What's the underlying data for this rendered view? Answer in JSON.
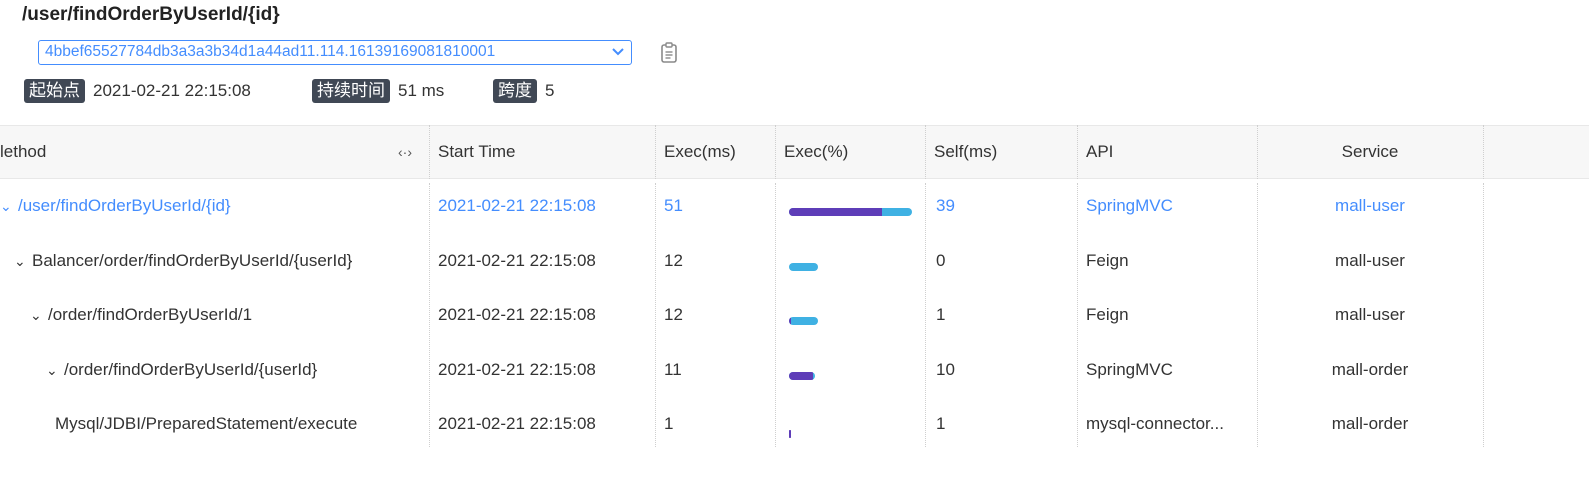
{
  "header": {
    "title": "/user/findOrderByUserId/{id}",
    "trace_id": "4bbef65527784db3a3a3b34d1a44ad11.114.16139169081810001",
    "start_label": "起始点",
    "start_value": "2021-02-21 22:15:08",
    "duration_label": "持续时间",
    "duration_value": "51 ms",
    "span_label": "跨度",
    "span_value": "5"
  },
  "icons": {
    "dropdown": "chevron-down-icon",
    "copy": "clipboard-icon",
    "resize": "resize-horizontal-icon",
    "expand": "chevron-down-icon"
  },
  "colors": {
    "accent": "#448dfe",
    "tag_bg": "#404855",
    "bar_total": "#3fb1e3",
    "bar_self": "#5e3db8"
  },
  "table": {
    "columns": {
      "method": "lethod",
      "resize_glyph": "‹·›",
      "start_time": "Start Time",
      "exec_ms": "Exec(ms)",
      "exec_pct": "Exec(%)",
      "self_ms": "Self(ms)",
      "api": "API",
      "service": "Service"
    },
    "rows": [
      {
        "method": "/user/findOrderByUserId/{id}",
        "expandable": true,
        "start_time": "2021-02-21 22:15:08",
        "exec_ms": "51",
        "self_ms": "39",
        "api": "SpringMVC",
        "service": "mall-user",
        "exec_fraction": 1.0,
        "self_fraction": 0.76
      },
      {
        "method": "Balancer/order/findOrderByUserId/{userId}",
        "expandable": true,
        "start_time": "2021-02-21 22:15:08",
        "exec_ms": "12",
        "self_ms": "0",
        "api": "Feign",
        "service": "mall-user",
        "exec_fraction": 0.235,
        "self_fraction": 0.0
      },
      {
        "method": "/order/findOrderByUserId/1",
        "expandable": true,
        "start_time": "2021-02-21 22:15:08",
        "exec_ms": "12",
        "self_ms": "1",
        "api": "Feign",
        "service": "mall-user",
        "exec_fraction": 0.235,
        "self_fraction": 0.02
      },
      {
        "method": "/order/findOrderByUserId/{userId}",
        "expandable": true,
        "start_time": "2021-02-21 22:15:08",
        "exec_ms": "11",
        "self_ms": "10",
        "api": "SpringMVC",
        "service": "mall-order",
        "exec_fraction": 0.215,
        "self_fraction": 0.196
      },
      {
        "method": "Mysql/JDBI/PreparedStatement/execute",
        "expandable": false,
        "start_time": "2021-02-21 22:15:08",
        "exec_ms": "1",
        "self_ms": "1",
        "api": "mysql-connector...",
        "service": "mall-order",
        "exec_fraction": 0.02,
        "self_fraction": 0.02
      }
    ]
  }
}
